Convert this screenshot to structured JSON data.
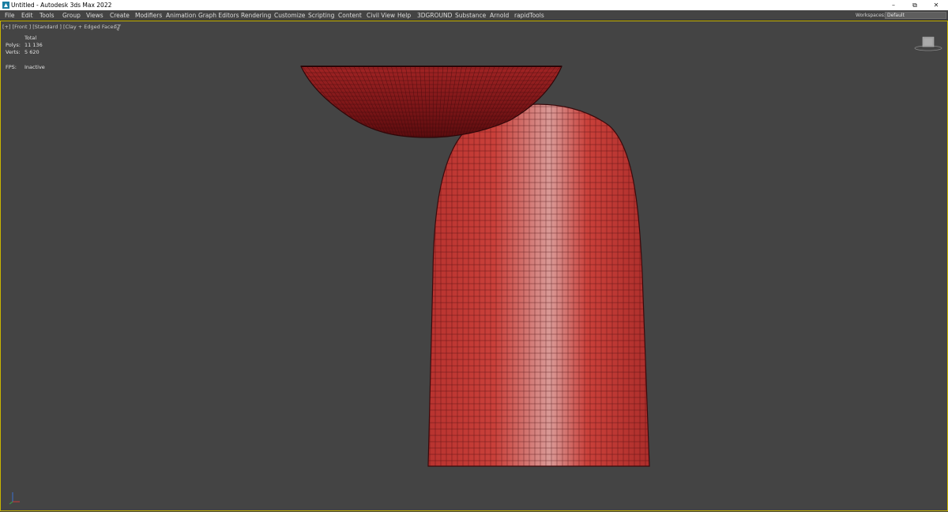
{
  "window": {
    "title": "Untitled - Autodesk 3ds Max 2022",
    "minimize_glyph": "–",
    "restore_glyph": "⧉",
    "close_glyph": "✕"
  },
  "menubar": {
    "items": [
      "File",
      "Edit",
      "Tools",
      "Group",
      "Views",
      "Create",
      "Modifiers",
      "Animation",
      "Graph Editors",
      "Rendering",
      "Customize",
      "Scripting",
      "Content",
      "Civil View",
      "Help",
      "3DGROUND",
      "Substance",
      "Arnold",
      "rapidTools"
    ],
    "workspaces_label": "Workspaces:",
    "workspace_value": "Default"
  },
  "viewport": {
    "label": "[+] [Front ] [Standard ] [Clay + Edged Faces ]",
    "filter_icon": "funnel-icon",
    "stats": {
      "header": "Total",
      "polys_label": "Polys:",
      "polys_value": "11 136",
      "verts_label": "Verts:",
      "verts_value": "5 620",
      "fps_label": "FPS:",
      "fps_value": "Inactive"
    }
  },
  "colors": {
    "viewport_bg": "#444444",
    "clay_red": "#c9403a",
    "clay_dark": "#6b0f12",
    "wire": "#3a0a0c",
    "active_border": "#c8b400"
  }
}
